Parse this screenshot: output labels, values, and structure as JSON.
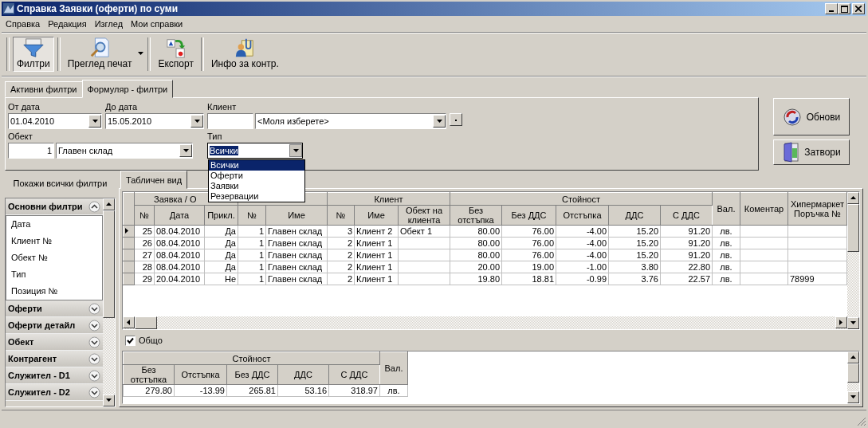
{
  "window": {
    "title": "Справка Заявки (оферти) по суми"
  },
  "menu": [
    "Справка",
    "Редакция",
    "Изглед",
    "Мои справки"
  ],
  "toolbar": [
    {
      "label": "Филтри",
      "kind": "filters",
      "on": true
    },
    {
      "label": "Преглед печат",
      "kind": "print_preview",
      "on": false
    },
    {
      "label": "Експорт",
      "kind": "export",
      "on": false
    },
    {
      "label": "Инфо за контр.",
      "kind": "info",
      "on": false
    }
  ],
  "filter_tabs": [
    {
      "label": "Активни филтри",
      "selected": false
    },
    {
      "label": "Формуляр - филтри",
      "selected": true
    }
  ],
  "filter_form": {
    "from_date": {
      "label": "От дата",
      "value": "01.04.2010"
    },
    "to_date": {
      "label": "До дата",
      "value": "15.05.2010"
    },
    "client": {
      "label": "Клиент",
      "placeholder": "<Моля изберете>"
    },
    "object": {
      "label": "Обект",
      "code": "1",
      "value": "Главен склад"
    },
    "type": {
      "label": "Тип",
      "value": "Всички",
      "expanded": true,
      "options": [
        {
          "label": "Всички",
          "selected": true
        },
        {
          "label": "Оферти",
          "selected": false
        },
        {
          "label": "Заявки",
          "selected": false
        },
        {
          "label": "Резервации",
          "selected": false
        }
      ]
    }
  },
  "actions": [
    {
      "label": "Обнови",
      "kind": "refresh"
    },
    {
      "label": "Затвори",
      "kind": "close"
    }
  ],
  "left_panel": {
    "show_all": "Покажи всички филтри",
    "groups": [
      {
        "label": "Основни филтри",
        "expanded": true,
        "children": [
          "Дата",
          "Клиент №",
          "Обект №",
          "Тип",
          "Позиция №"
        ]
      },
      {
        "label": "Оферти",
        "expanded": false
      },
      {
        "label": "Оферти детайл",
        "expanded": false
      },
      {
        "label": "Обект",
        "expanded": false
      },
      {
        "label": "Контрагент",
        "expanded": false
      },
      {
        "label": "Служител - D1",
        "expanded": false
      },
      {
        "label": "Служител - D2",
        "expanded": false
      }
    ]
  },
  "view_tabs": [
    {
      "label": "Табличен вид",
      "selected": true
    }
  ],
  "table": {
    "groups": [
      {
        "label": "Заявка / О",
        "columns": [
          {
            "label": "№",
            "kind": "number"
          },
          {
            "label": "Дата",
            "kind": "text"
          },
          {
            "label": "Прикл.",
            "kind": "flag"
          }
        ]
      },
      {
        "columns": [
          {
            "label": "№",
            "kind": "number"
          },
          {
            "label": "Име",
            "kind": "text"
          }
        ]
      },
      {
        "label": "Клиент",
        "columns": [
          {
            "label": "№",
            "kind": "number"
          },
          {
            "label": "Име",
            "kind": "text"
          },
          {
            "label": "Обект на клиента",
            "kind": "text"
          }
        ]
      },
      {
        "label": "Стойност",
        "columns": [
          {
            "label": "Без отстъпка",
            "kind": "number"
          },
          {
            "label": "Без ДДС",
            "kind": "number"
          },
          {
            "label": "Отстъпка",
            "kind": "number"
          },
          {
            "label": "ДДС",
            "kind": "number"
          },
          {
            "label": "С ДДС",
            "kind": "number"
          }
        ]
      },
      {
        "columns": [
          {
            "label": "Вал.",
            "kind": "currency"
          }
        ]
      },
      {
        "columns": [
          {
            "label": "Коментар",
            "kind": "text"
          }
        ]
      },
      {
        "columns": [
          {
            "label": "Хипермаркет Поръчка №",
            "kind": "text"
          }
        ]
      }
    ],
    "rows": [
      {
        "selected": true,
        "cells": [
          "25",
          "08.04.2010",
          "Да",
          "1",
          "Главен склад",
          "3",
          "Клиент 2",
          "Обект 1",
          "80.00",
          "76.00",
          "-4.00",
          "15.20",
          "91.20",
          "лв.",
          null,
          null
        ]
      },
      {
        "selected": false,
        "cells": [
          "26",
          "08.04.2010",
          "Да",
          "1",
          "Главен склад",
          "2",
          "Клиент 1",
          null,
          "80.00",
          "76.00",
          "-4.00",
          "15.20",
          "91.20",
          "лв.",
          null,
          null
        ]
      },
      {
        "selected": false,
        "cells": [
          "27",
          "08.04.2010",
          "Да",
          "1",
          "Главен склад",
          "2",
          "Клиент 1",
          null,
          "80.00",
          "76.00",
          "-4.00",
          "15.20",
          "91.20",
          "лв.",
          null,
          null
        ]
      },
      {
        "selected": false,
        "cells": [
          "28",
          "08.04.2010",
          "Да",
          "1",
          "Главен склад",
          "2",
          "Клиент 1",
          null,
          "20.00",
          "19.00",
          "-1.00",
          "3.80",
          "22.80",
          "лв.",
          null,
          null
        ]
      },
      {
        "selected": false,
        "cells": [
          "29",
          "20.04.2010",
          "Не",
          "1",
          "Главен склад",
          "2",
          "Клиент 1",
          null,
          "19.80",
          "18.81",
          "-0.99",
          "3.76",
          "22.57",
          "лв.",
          null,
          "78999"
        ]
      }
    ]
  },
  "total": {
    "label": "Общо",
    "checked": true
  },
  "totals_table": {
    "groups": [
      {
        "label": "Стойност",
        "columns": [
          {
            "label": "Без отстъпка",
            "kind": "number"
          },
          {
            "label": "Отстъпка",
            "kind": "number"
          },
          {
            "label": "Без ДДС",
            "kind": "number"
          },
          {
            "label": "ДДС",
            "kind": "number"
          },
          {
            "label": "С ДДС",
            "kind": "number"
          }
        ]
      },
      {
        "columns": [
          {
            "label": "Вал.",
            "kind": "currency"
          }
        ]
      }
    ],
    "rows": [
      {
        "cells": [
          "279.80",
          "-13.99",
          "265.81",
          "53.16",
          "318.97",
          "лв."
        ]
      }
    ]
  }
}
